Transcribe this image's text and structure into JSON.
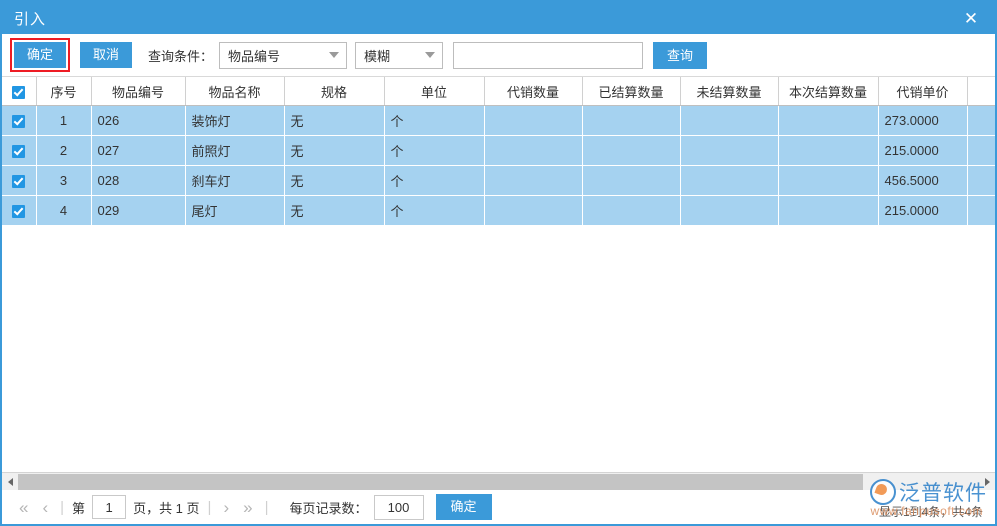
{
  "window": {
    "title": "引入",
    "close_icon": "close-icon"
  },
  "toolbar": {
    "confirm_label": "确定",
    "cancel_label": "取消",
    "condition_label": "查询条件：",
    "condition_value": "物品编号",
    "match_value": "模糊",
    "search_value": "",
    "search_placeholder": "",
    "query_label": "查询",
    "dropdown_icon": "chevron-down-icon",
    "highlight_color": "#ee1c24",
    "accent_color": "#3b9ad9"
  },
  "grid": {
    "header_checkbox_checked": true,
    "columns": [
      {
        "key": "check",
        "label": ""
      },
      {
        "key": "seq",
        "label": "序号"
      },
      {
        "key": "code",
        "label": "物品编号"
      },
      {
        "key": "name",
        "label": "物品名称"
      },
      {
        "key": "spec",
        "label": "规格"
      },
      {
        "key": "unit",
        "label": "单位"
      },
      {
        "key": "consign_qty",
        "label": "代销数量"
      },
      {
        "key": "settled_qty",
        "label": "已结算数量"
      },
      {
        "key": "unsettled_qty",
        "label": "未结算数量"
      },
      {
        "key": "current_settle_qty",
        "label": "本次结算数量"
      },
      {
        "key": "consign_price",
        "label": "代销单价"
      }
    ],
    "rows": [
      {
        "checked": true,
        "seq": "1",
        "code": "026",
        "name": "装饰灯",
        "spec": "无",
        "unit": "个",
        "consign_qty": "",
        "settled_qty": "",
        "unsettled_qty": "",
        "current_settle_qty": "",
        "consign_price": "273.0000"
      },
      {
        "checked": true,
        "seq": "2",
        "code": "027",
        "name": "前照灯",
        "spec": "无",
        "unit": "个",
        "consign_qty": "",
        "settled_qty": "",
        "unsettled_qty": "",
        "current_settle_qty": "",
        "consign_price": "215.0000"
      },
      {
        "checked": true,
        "seq": "3",
        "code": "028",
        "name": "刹车灯",
        "spec": "无",
        "unit": "个",
        "consign_qty": "",
        "settled_qty": "",
        "unsettled_qty": "",
        "current_settle_qty": "",
        "consign_price": "456.5000"
      },
      {
        "checked": true,
        "seq": "4",
        "code": "029",
        "name": "尾灯",
        "spec": "无",
        "unit": "个",
        "consign_qty": "",
        "settled_qty": "",
        "unsettled_qty": "",
        "current_settle_qty": "",
        "consign_price": "215.0000"
      }
    ],
    "row_selected_color": "#a5d2f0"
  },
  "scrollbar": {
    "left_arrow_icon": "triangle-left-icon",
    "right_arrow_icon": "triangle-right-icon"
  },
  "pager": {
    "first_icon": "«",
    "prev_icon": "‹",
    "next_icon": "›",
    "last_icon": "»",
    "page_prefix": "第",
    "page_value": "1",
    "page_suffix": "页，共 1 页",
    "page_size_label": "每页记录数：",
    "page_size_value": "100",
    "confirm_label": "确定",
    "record_info": "显示1到4条，共4条"
  },
  "watermark": {
    "brand": "泛普软件",
    "url": "www.fanpusoft.com",
    "logo_icon": "fanpu-logo-icon"
  }
}
